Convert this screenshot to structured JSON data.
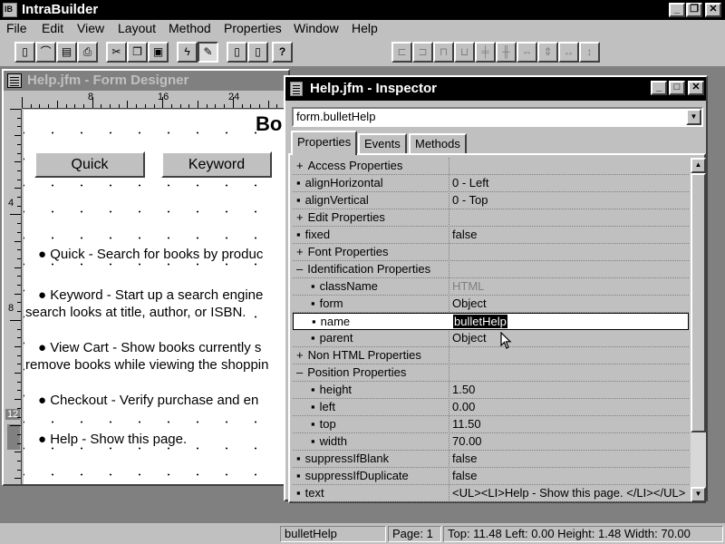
{
  "app": {
    "title": "IntraBuilder"
  },
  "menu": [
    "File",
    "Edit",
    "View",
    "Layout",
    "Method",
    "Properties",
    "Window",
    "Help"
  ],
  "toolbar": {
    "tools": [
      {
        "name": "new-icon",
        "glyph": "▯"
      },
      {
        "name": "open-icon",
        "glyph": "⌒"
      },
      {
        "name": "save-icon",
        "glyph": "▤"
      },
      {
        "name": "print-icon",
        "glyph": "⎙"
      },
      {
        "name": "cut-icon",
        "glyph": "✂"
      },
      {
        "name": "copy-icon",
        "glyph": "❐"
      },
      {
        "name": "paste-icon",
        "glyph": "▣"
      },
      {
        "name": "run-icon",
        "glyph": "ϟ"
      },
      {
        "name": "design-icon",
        "glyph": "✎"
      },
      {
        "name": "new-form-icon",
        "glyph": "▯"
      },
      {
        "name": "new-report-icon",
        "glyph": "▯"
      },
      {
        "name": "help-icon",
        "glyph": "?"
      }
    ],
    "align_tools": [
      "align-left-icon",
      "align-right-icon",
      "align-top-icon",
      "align-bottom-icon",
      "align-center-h-icon",
      "align-center-v-icon",
      "space-h-icon",
      "space-v-icon",
      "same-width-icon",
      "same-height-icon"
    ]
  },
  "designer": {
    "title": "Help.jfm - Form Designer",
    "ruler_h": [
      "8",
      "16",
      "24"
    ],
    "ruler_v": [
      "4",
      "8",
      "12"
    ],
    "heading": "Bo",
    "buttons": [
      "Quick",
      "Keyword"
    ],
    "bullets": [
      "● Quick - Search for books by produc",
      "● Keyword - Start up a search engine",
      "search looks at title, author, or ISBN.",
      "● View Cart - Show books currently s",
      "remove books while viewing the shoppin",
      "● Checkout - Verify purchase and en",
      "● Help - Show this page."
    ]
  },
  "inspector": {
    "title": "Help.jfm - Inspector",
    "selected_object": "form.bulletHelp",
    "tabs": [
      "Properties",
      "Events",
      "Methods"
    ],
    "properties": [
      {
        "marker": "+",
        "name": "Access Properties",
        "value": ""
      },
      {
        "marker": "▪",
        "name": "alignHorizontal",
        "value": "0 - Left"
      },
      {
        "marker": "▪",
        "name": "alignVertical",
        "value": "0 - Top"
      },
      {
        "marker": "+",
        "name": "Edit Properties",
        "value": ""
      },
      {
        "marker": "▪",
        "name": "fixed",
        "value": "false"
      },
      {
        "marker": "+",
        "name": "Font Properties",
        "value": ""
      },
      {
        "marker": "–",
        "name": "Identification Properties",
        "value": ""
      },
      {
        "marker": "▪",
        "name": "className",
        "value": "HTML",
        "sub": true,
        "dim": true
      },
      {
        "marker": "▪",
        "name": "form",
        "value": "Object",
        "sub": true
      },
      {
        "marker": "▪",
        "name": "name",
        "value": "bulletHelp",
        "sub": true,
        "editing": true
      },
      {
        "marker": "▪",
        "name": "parent",
        "value": "Object",
        "sub": true
      },
      {
        "marker": "+",
        "name": "Non HTML Properties",
        "value": ""
      },
      {
        "marker": "–",
        "name": "Position Properties",
        "value": ""
      },
      {
        "marker": "▪",
        "name": "height",
        "value": "1.50",
        "sub": true
      },
      {
        "marker": "▪",
        "name": "left",
        "value": "0.00",
        "sub": true
      },
      {
        "marker": "▪",
        "name": "top",
        "value": "11.50",
        "sub": true
      },
      {
        "marker": "▪",
        "name": "width",
        "value": "70.00",
        "sub": true
      },
      {
        "marker": "▪",
        "name": "suppressIfBlank",
        "value": "false"
      },
      {
        "marker": "▪",
        "name": "suppressIfDuplicate",
        "value": "false"
      },
      {
        "marker": "▪",
        "name": "text",
        "value": "<UL><LI>Help - Show this page. </LI></UL>"
      }
    ]
  },
  "status": {
    "object": "bulletHelp",
    "page": "Page: 1",
    "position": "Top: 11.48 Left: 0.00 Height: 1.48 Width: 70.00"
  }
}
